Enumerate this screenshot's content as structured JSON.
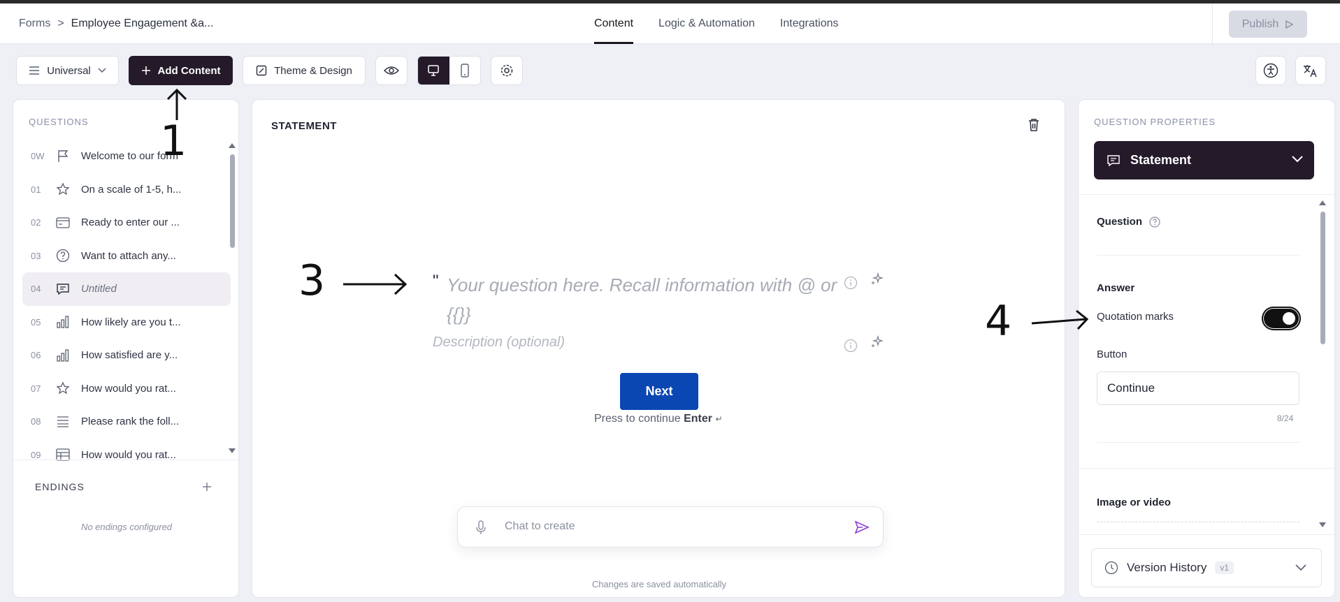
{
  "header": {
    "breadcrumb_root": "Forms",
    "breadcrumb_sep": ">",
    "breadcrumb_current": "Employee Engagement &a...",
    "tabs": [
      {
        "label": "Content"
      },
      {
        "label": "Logic & Automation"
      },
      {
        "label": "Integrations"
      }
    ],
    "publish_label": "Publish"
  },
  "toolbar": {
    "universal_label": "Universal",
    "add_content_label": "Add Content",
    "theme_label": "Theme & Design"
  },
  "questions_panel": {
    "title": "QUESTIONS",
    "items": [
      {
        "num": "0W",
        "icon": "flag-icon",
        "text": "Welcome to our form"
      },
      {
        "num": "01",
        "icon": "star-icon",
        "text": "On a scale of 1-5, h..."
      },
      {
        "num": "02",
        "icon": "card-icon",
        "text": "Ready to enter our ..."
      },
      {
        "num": "03",
        "icon": "question-circle-icon",
        "text": "Want to attach any..."
      },
      {
        "num": "04",
        "icon": "comment-icon",
        "text": "Untitled"
      },
      {
        "num": "05",
        "icon": "bar-chart-icon",
        "text": "How likely are you t..."
      },
      {
        "num": "06",
        "icon": "bar-chart-icon",
        "text": "How satisfied are y..."
      },
      {
        "num": "07",
        "icon": "star-icon",
        "text": "How would you rat..."
      },
      {
        "num": "08",
        "icon": "list-icon",
        "text": "Please rank the foll..."
      },
      {
        "num": "09",
        "icon": "table-icon",
        "text": "How would you rat..."
      }
    ],
    "endings_title": "ENDINGS",
    "endings_empty": "No endings configured"
  },
  "editor": {
    "title": "STATEMENT",
    "quote_mark": "\"",
    "question_placeholder_line1": "Your question here. Recall information with @ or",
    "question_placeholder_line2": "{{}}",
    "description_placeholder": "Description (optional)",
    "next_label": "Next",
    "press_hint_prefix": "Press to continue",
    "press_hint_key": "Enter",
    "chat_placeholder": "Chat to create",
    "saved_text": "Changes are saved automatically"
  },
  "properties": {
    "title": "QUESTION PROPERTIES",
    "type_label": "Statement",
    "question_label": "Question",
    "answer_label": "Answer",
    "quotation_label": "Quotation marks",
    "quotation_on": true,
    "button_label": "Button",
    "button_value": "Continue",
    "char_count": "8/24",
    "image_label": "Image or video",
    "version_label": "Version History",
    "version_badge": "v1"
  },
  "annotations": {
    "a1": "1",
    "a3": "3",
    "a4": "4"
  }
}
